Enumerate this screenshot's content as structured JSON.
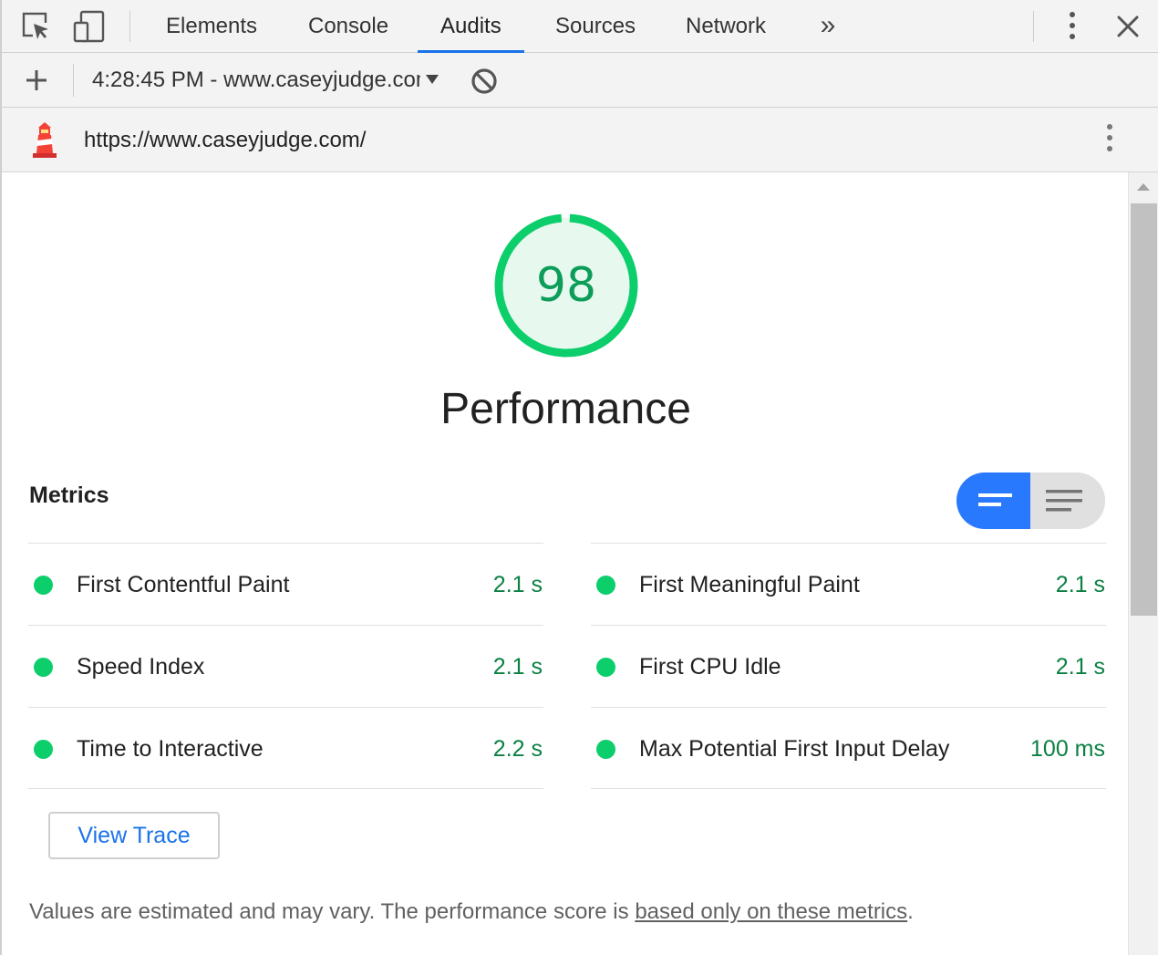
{
  "devtools": {
    "tabs": [
      {
        "label": "Elements"
      },
      {
        "label": "Console"
      },
      {
        "label": "Audits"
      },
      {
        "label": "Sources"
      },
      {
        "label": "Network"
      }
    ],
    "active_tab": "Audits",
    "more_tabs_symbol": "»"
  },
  "toolbar": {
    "report_selector": "4:28:45 PM - www.caseyjudge.com"
  },
  "urlbar": {
    "url": "https://www.caseyjudge.com/"
  },
  "report": {
    "score": "98",
    "score_value": 98,
    "score_color": "#0cce6b",
    "category_title": "Performance",
    "metrics_title": "Metrics",
    "metrics_left": [
      {
        "name": "First Contentful Paint",
        "value": "2.1 s"
      },
      {
        "name": "Speed Index",
        "value": "2.1 s"
      },
      {
        "name": "Time to Interactive",
        "value": "2.2 s"
      }
    ],
    "metrics_right": [
      {
        "name": "First Meaningful Paint",
        "value": "2.1 s"
      },
      {
        "name": "First CPU Idle",
        "value": "2.1 s"
      },
      {
        "name": "Max Potential First Input Delay",
        "value": "100 ms"
      }
    ],
    "pass_color": "#0cce6b",
    "view_trace_label": "View Trace",
    "footnote_text": "Values are estimated and may vary. The performance score is ",
    "footnote_link": "based only on these metrics",
    "footnote_end": "."
  },
  "icons": {
    "inspect": "inspect-element-icon",
    "device": "device-toolbar-icon",
    "more_tabs": "chevron-double-right-icon",
    "kebab": "more-vert-icon",
    "close": "close-icon",
    "plus": "plus-icon",
    "block": "clear-block-icon",
    "lighthouse": "lighthouse-logo-icon",
    "view_expanded": "view-list-icon",
    "view_compact": "view-compact-icon"
  }
}
